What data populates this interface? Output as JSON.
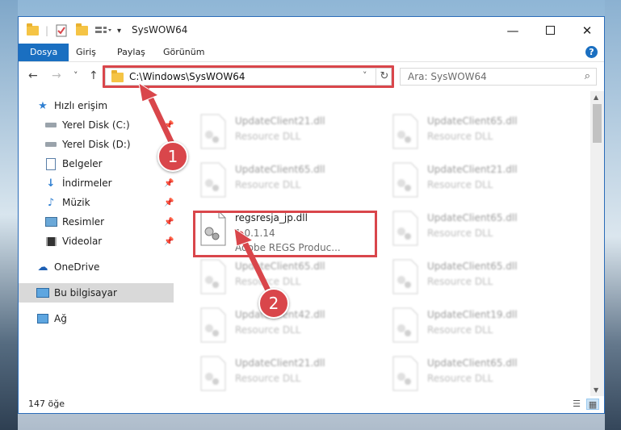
{
  "window": {
    "title": "SysWOW64",
    "minimize_icon": "minimize-icon",
    "maximize_icon": "maximize-icon",
    "close_icon": "close-icon"
  },
  "ribbon": {
    "tabs": [
      {
        "label": "Dosya",
        "active": true
      },
      {
        "label": "Giriş"
      },
      {
        "label": "Paylaş"
      },
      {
        "label": "Görünüm"
      }
    ],
    "help": "?"
  },
  "nav": {
    "back": "←",
    "forward": "→",
    "recent": "˅",
    "up": "↑",
    "address": "C:\\Windows\\SysWOW64",
    "refresh": "↻",
    "search_placeholder": "Ara: SysWOW64"
  },
  "sidebar": {
    "items": [
      {
        "label": "Hızlı erişim",
        "icon": "star-icon",
        "pinned": false
      },
      {
        "label": "Yerel Disk (C:)",
        "icon": "drive-icon",
        "pinned": true
      },
      {
        "label": "Yerel Disk (D:)",
        "icon": "drive-icon",
        "pinned": true
      },
      {
        "label": "Belgeler",
        "icon": "documents-icon",
        "pinned": true
      },
      {
        "label": "İndirmeler",
        "icon": "download-icon",
        "pinned": true
      },
      {
        "label": "Müzik",
        "icon": "music-icon",
        "pinned": true
      },
      {
        "label": "Resimler",
        "icon": "pictures-icon",
        "pinned": true
      },
      {
        "label": "Videolar",
        "icon": "video-icon",
        "pinned": true
      },
      {
        "label": "OneDrive",
        "icon": "cloud-icon",
        "pinned": false
      },
      {
        "label": "Bu bilgisayar",
        "icon": "computer-icon",
        "pinned": false
      },
      {
        "label": "Ağ",
        "icon": "network-icon",
        "pinned": false
      }
    ]
  },
  "files": {
    "left_column": [
      {
        "name": "UpdateClient21.dll",
        "sub": "Resource DLL"
      },
      {
        "name": "UpdateClient65.dll",
        "sub": "Resource DLL"
      },
      {
        "name": "regsresja_jp.dll",
        "sub": "1.0.1.14",
        "sub2": "Adobe REGS     Produc..."
      },
      {
        "name": "UpdateClient65.dll",
        "sub": "Resource DLL"
      },
      {
        "name": "UpdateClient42.dll",
        "sub": "Resource DLL"
      },
      {
        "name": "UpdateClient21.dll",
        "sub": "Resource DLL"
      }
    ],
    "right_column": [
      {
        "name": "UpdateClient65.dll",
        "sub": "Resource DLL"
      },
      {
        "name": "UpdateClient21.dll",
        "sub": "Resource DLL"
      },
      {
        "name": "UpdateClient65.dll",
        "sub": "Resource DLL"
      },
      {
        "name": "UpdateClient65.dll",
        "sub": "Resource DLL"
      },
      {
        "name": "UpdateClient19.dll",
        "sub": "Resource DLL"
      },
      {
        "name": "UpdateClient65.dll",
        "sub": "Resource DLL"
      }
    ]
  },
  "annotations": {
    "step1": "1",
    "step2": "2",
    "accent": "#d9464b"
  },
  "status": {
    "count": "147 öğe"
  }
}
